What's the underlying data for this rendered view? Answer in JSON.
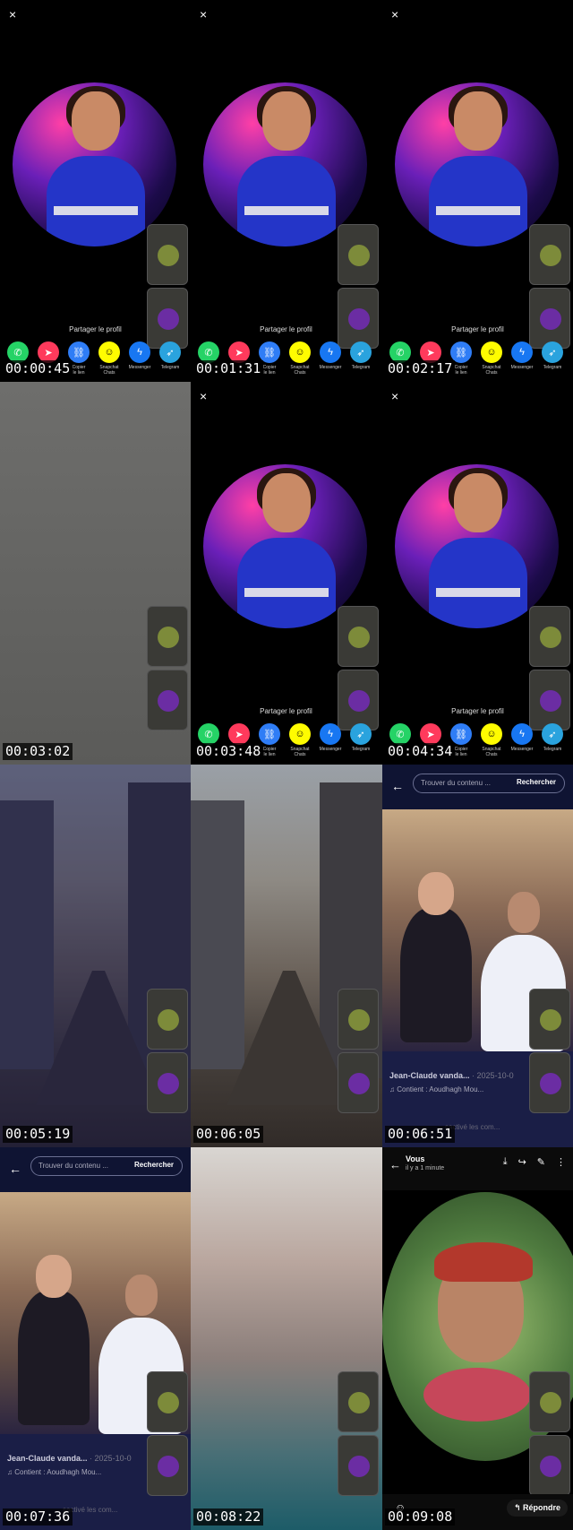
{
  "share": {
    "close": "×",
    "label": "Partager le profil",
    "apps": [
      {
        "name": "whatsapp-icon",
        "glyph": "✆",
        "color": "#25d366",
        "label": ""
      },
      {
        "name": "send-icon",
        "glyph": "➤",
        "color": "#ff3a5c",
        "label": ""
      },
      {
        "name": "link-icon",
        "glyph": "⛓",
        "color": "#2f7df6",
        "label": "Copier\nle lien"
      },
      {
        "name": "snapchat-icon",
        "glyph": "☺",
        "color": "#fffc00",
        "label": "Snapchat\nChats"
      },
      {
        "name": "messenger-icon",
        "glyph": "ϟ",
        "color": "#1877f2",
        "label": "Messenger"
      },
      {
        "name": "telegram-icon",
        "glyph": "➶",
        "color": "#2aa3de",
        "label": "Telegram"
      }
    ]
  },
  "search": {
    "back": "←",
    "placeholder": "Trouver du contenu ...",
    "button": "Rechercher"
  },
  "post": {
    "author": "Jean-Claude vanda...",
    "date": "· 2025-10-0",
    "music": "♫ Contient : Aoudhagh Mou...",
    "tiny": "sactivé les com..."
  },
  "viewer": {
    "name": "Vous",
    "time": "il y a 1 minute",
    "reply": "Répondre"
  },
  "timestamps": [
    "00:00:45",
    "00:01:31",
    "00:02:17",
    "00:03:02",
    "00:03:48",
    "00:04:34",
    "00:05:19",
    "00:06:05",
    "00:06:51",
    "00:07:36",
    "00:08:22",
    "00:09:08"
  ],
  "colors": {
    "accent": "#2435c8",
    "dark_panel": "#1a1e46"
  }
}
